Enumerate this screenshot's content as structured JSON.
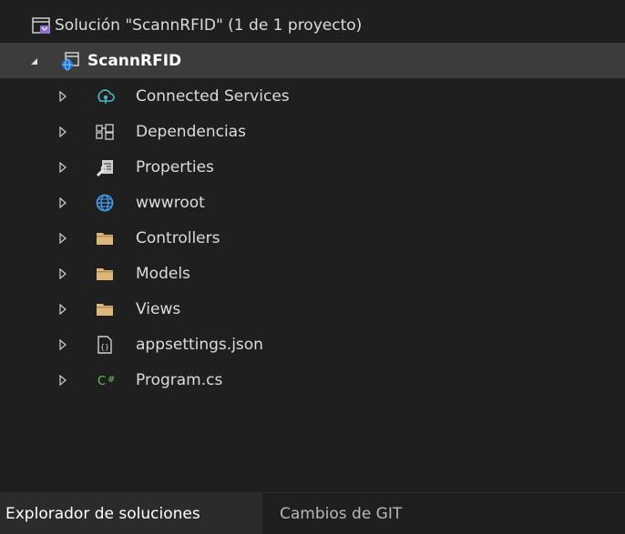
{
  "solution": {
    "title": "Solución \"ScannRFID\"  (1 de 1 proyecto)"
  },
  "project": {
    "name": "ScannRFID"
  },
  "items": [
    {
      "label": "Connected Services",
      "icon": "connected-services-icon"
    },
    {
      "label": "Dependencias",
      "icon": "dependencies-icon"
    },
    {
      "label": "Properties",
      "icon": "properties-icon"
    },
    {
      "label": "wwwroot",
      "icon": "globe-icon"
    },
    {
      "label": "Controllers",
      "icon": "folder-icon"
    },
    {
      "label": "Models",
      "icon": "folder-icon"
    },
    {
      "label": "Views",
      "icon": "folder-icon"
    },
    {
      "label": "appsettings.json",
      "icon": "json-file-icon"
    },
    {
      "label": "Program.cs",
      "icon": "csharp-file-icon"
    }
  ],
  "tabs": {
    "active": "Explorador de soluciones",
    "inactive": "Cambios de GIT"
  },
  "colors": {
    "folder": "#dcb67a",
    "globe": "#3f9ae8",
    "csharp": "#68c15a",
    "selected_row": "#3c3c3c",
    "solution_icon": "#8a6cd6"
  }
}
